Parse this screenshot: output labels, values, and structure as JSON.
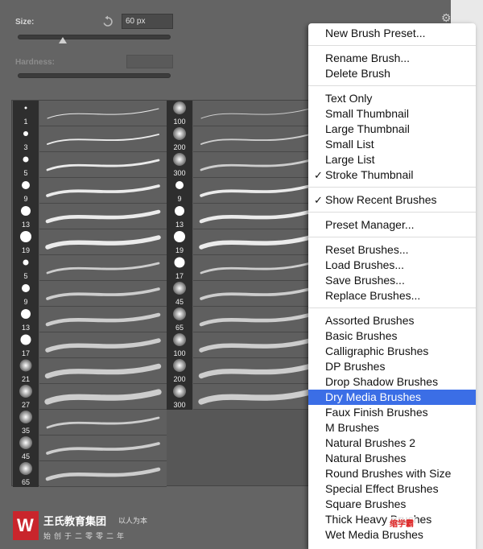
{
  "panel": {
    "size_label": "Size:",
    "size_value": "60 px",
    "size_slider_fraction": 0.29,
    "hardness_label": "Hardness:"
  },
  "brushes": {
    "col1": [
      {
        "size": "1"
      },
      {
        "size": "3"
      },
      {
        "size": "5"
      },
      {
        "size": "9"
      },
      {
        "size": "13"
      },
      {
        "size": "19"
      },
      {
        "size": "5"
      },
      {
        "size": "9"
      },
      {
        "size": "13"
      },
      {
        "size": "17"
      },
      {
        "size": "21"
      },
      {
        "size": "27"
      },
      {
        "size": "35"
      },
      {
        "size": "45"
      },
      {
        "size": "65"
      }
    ],
    "col2": [
      {
        "size": "100"
      },
      {
        "size": "200"
      },
      {
        "size": "300"
      },
      {
        "size": "9"
      },
      {
        "size": "13"
      },
      {
        "size": "19"
      },
      {
        "size": "17"
      },
      {
        "size": "45"
      },
      {
        "size": "65"
      },
      {
        "size": "100"
      },
      {
        "size": "200"
      },
      {
        "size": "300"
      }
    ]
  },
  "menu": {
    "items": [
      {
        "label": "New Brush Preset..."
      },
      {
        "label": "Rename Brush..."
      },
      {
        "label": "Delete Brush"
      },
      {
        "label": "Text Only"
      },
      {
        "label": "Small Thumbnail"
      },
      {
        "label": "Large Thumbnail"
      },
      {
        "label": "Small List"
      },
      {
        "label": "Large List"
      },
      {
        "label": "Stroke Thumbnail",
        "check": "✓"
      },
      {
        "label": "Show Recent Brushes",
        "check": "✓"
      },
      {
        "label": "Preset Manager..."
      },
      {
        "label": "Reset Brushes..."
      },
      {
        "label": "Load Brushes..."
      },
      {
        "label": "Save Brushes..."
      },
      {
        "label": "Replace Brushes..."
      },
      {
        "label": "Assorted Brushes"
      },
      {
        "label": "Basic Brushes"
      },
      {
        "label": "Calligraphic Brushes"
      },
      {
        "label": "DP Brushes"
      },
      {
        "label": "Drop Shadow Brushes"
      },
      {
        "label": "Dry Media Brushes",
        "highlighted": true
      },
      {
        "label": "Faux Finish Brushes"
      },
      {
        "label": "M Brushes"
      },
      {
        "label": "Natural Brushes 2"
      },
      {
        "label": "Natural Brushes"
      },
      {
        "label": "Round Brushes with Size"
      },
      {
        "label": "Special Effect Brushes"
      },
      {
        "label": "Square Brushes"
      },
      {
        "label": "Thick Heavy Brushes"
      },
      {
        "label": "Wet Media Brushes"
      }
    ]
  },
  "logo": {
    "mark": "W",
    "name": "王氏教育集团",
    "slogan": "以人为本",
    "sub": "始创于二零零二年"
  },
  "watermark": "缩学霸",
  "colors": {
    "panel_bg": "#646464",
    "highlight": "#3b6ee6",
    "brand_red": "#c9252c"
  }
}
